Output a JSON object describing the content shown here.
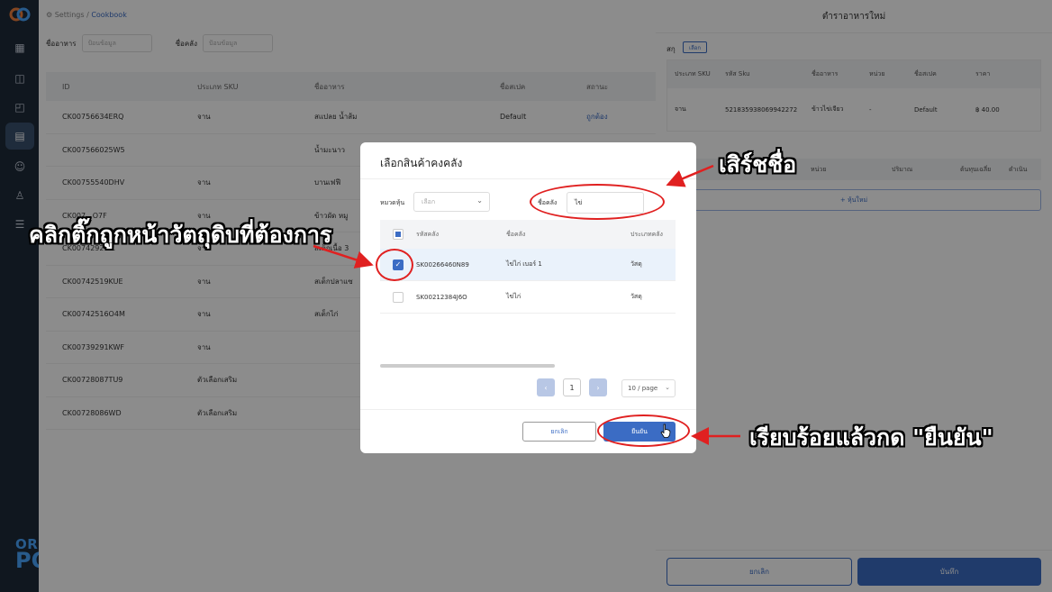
{
  "breadcrumb": {
    "settings": "Settings",
    "sep": "/",
    "current": "Cookbook"
  },
  "filters": {
    "food_name_label": "ชื่ออาหาร",
    "food_name_placeholder": "ป้อนข้อมูล",
    "warehouse_label": "ชื่อคลัง",
    "warehouse_placeholder": "ป้อนข้อมูล"
  },
  "main_table": {
    "headers": [
      "ID",
      "ประเภท SKU",
      "ชื่ออาหาร",
      "ชื่อสเปค",
      "สถานะ"
    ],
    "rows": [
      [
        "CK00756634ERQ",
        "จาน",
        "สแปลย น้ำส้ม",
        "Default",
        "ถูกต้อง"
      ],
      [
        "CK007566025W5",
        "",
        "น้ำมะนาว",
        "",
        ""
      ],
      [
        "CK00755540DHV",
        "จาน",
        "บานเฟฟี",
        "",
        ""
      ],
      [
        "CK007...O7F",
        "จาน",
        "ข้าวผัด หมู",
        "",
        ""
      ],
      [
        "CK00742921...",
        "จาน",
        "สเต็กเนื้อ 3",
        "",
        ""
      ],
      [
        "CK00742519KUE",
        "จาน",
        "สเต็กปลาแซ",
        "",
        ""
      ],
      [
        "CK00742516O4M",
        "จาน",
        "สเต็กไก่",
        "",
        ""
      ],
      [
        "CK00739291KWF",
        "จาน",
        "",
        "",
        ""
      ],
      [
        "CK00728087TU9",
        "ตัวเลือกเสริม",
        "",
        "",
        ""
      ],
      [
        "CK00728086WD",
        "ตัวเลือกเสริม",
        "",
        "",
        ""
      ]
    ]
  },
  "drawer": {
    "title": "ตำราอาหารใหม่",
    "sku_label": "สกุ",
    "sku_button": "เลือก",
    "headers": [
      "ประเภท SKU",
      "รหัส Sku",
      "ชื่ออาหาร",
      "หน่วย",
      "ชื่อสเปค",
      "ราคา"
    ],
    "row": [
      "จาน",
      "521835938069942272",
      "ข้าวไข่เจียว",
      "-",
      "Default",
      "฿ 40.00"
    ],
    "headers2": [
      "หน่วย",
      "ปริมาณ",
      "ต้นทุนเฉลี่ย",
      "ดำเนิน"
    ],
    "add_button": "+ หุ้นใหม่",
    "cancel": "ยกเลิก",
    "save": "บันทึก"
  },
  "modal": {
    "title": "เลือกสินค้าคงคลัง",
    "category_label": "หมวดหุ้น",
    "category_placeholder": "เลือก",
    "warehouse_label": "ชื่อคลัง",
    "warehouse_value": "ไข่",
    "headers": [
      "รหัสคลัง",
      "ชื่อคลัง",
      "ประเภทคลัง"
    ],
    "rows": [
      {
        "code": "SK00266460N89",
        "name": "ไข่ไก่ เบอร์ 1",
        "type": "วัสดุ",
        "checked": true
      },
      {
        "code": "SK00212384J6O",
        "name": "ไข่ไก่",
        "type": "วัสดุ",
        "checked": false
      }
    ],
    "page": "1",
    "page_size": "10 / page",
    "cancel": "ยกเลิก",
    "confirm": "ยืนยัน"
  },
  "annotations": {
    "insert_name": "เสิร์ชชื่อ",
    "tick_item": "คลิกติ๊กถูกหน้าวัตถุดิบที่ต้องการ",
    "confirm_hint": "เรียบร้อยแล้วกด \"ยืนยัน\""
  },
  "brand": {
    "line1": "ORDER",
    "line2": "POS"
  },
  "colors": {
    "accent": "#3b6cc4",
    "annotation_red": "#e02020",
    "sidebar": "#1e2a3a"
  }
}
